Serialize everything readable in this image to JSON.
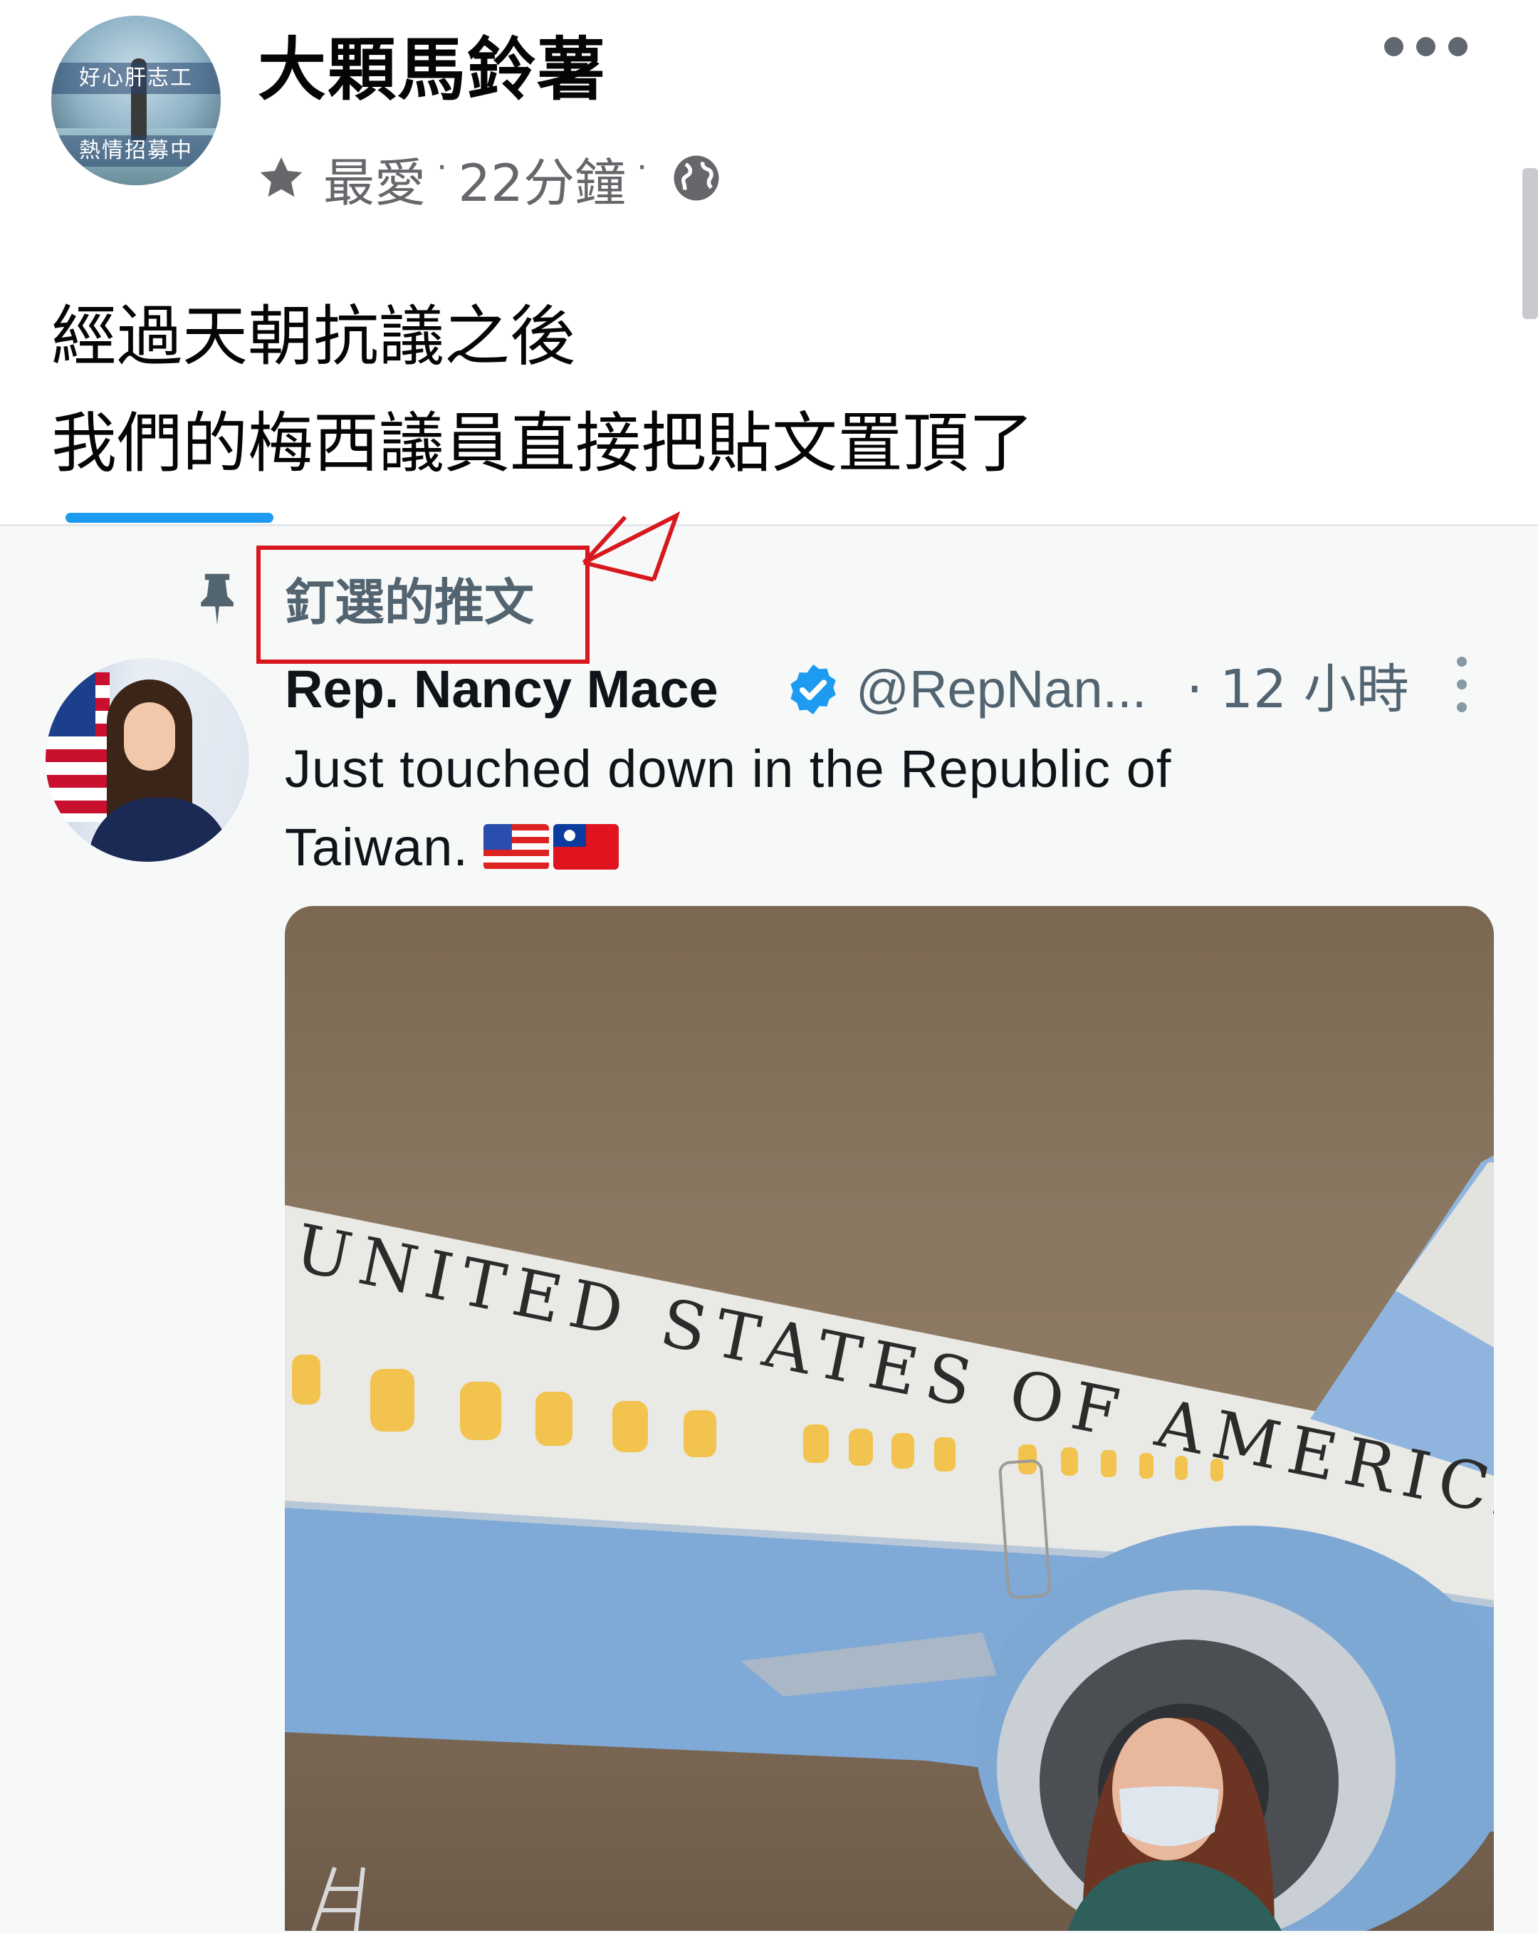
{
  "facebook_post": {
    "page_name": "大顆馬鈴薯",
    "avatar_text": [
      "好心肝志工",
      "熱情招募中"
    ],
    "meta": {
      "favorite_label": "最愛",
      "separator": "·",
      "time": "22分鐘",
      "separator2": "·"
    },
    "text_lines": [
      "經過天朝抗議之後",
      "我們的梅西議員直接把貼文置頂了"
    ],
    "icons": [
      "more-icon",
      "star-icon",
      "globe-icon"
    ]
  },
  "tweet": {
    "pinned_label": "釘選的推文",
    "author_name": "Rep. Nancy Mace",
    "handle": "@RepNan...",
    "time": "· 12 小時",
    "text_lines": [
      "Just touched down in the Republic of",
      "Taiwan."
    ],
    "emoji": [
      "us-flag",
      "taiwan-flag"
    ],
    "photo_text": "UNITED STATES OF AMERICA",
    "icons": [
      "pin-icon",
      "verified-icon",
      "tweet-more-icon"
    ]
  },
  "colors": {
    "highlight_box": "#d7191f",
    "verified": "#1d9bf0",
    "secondary_text": "#65676b",
    "tweet_secondary_text": "#536471"
  }
}
